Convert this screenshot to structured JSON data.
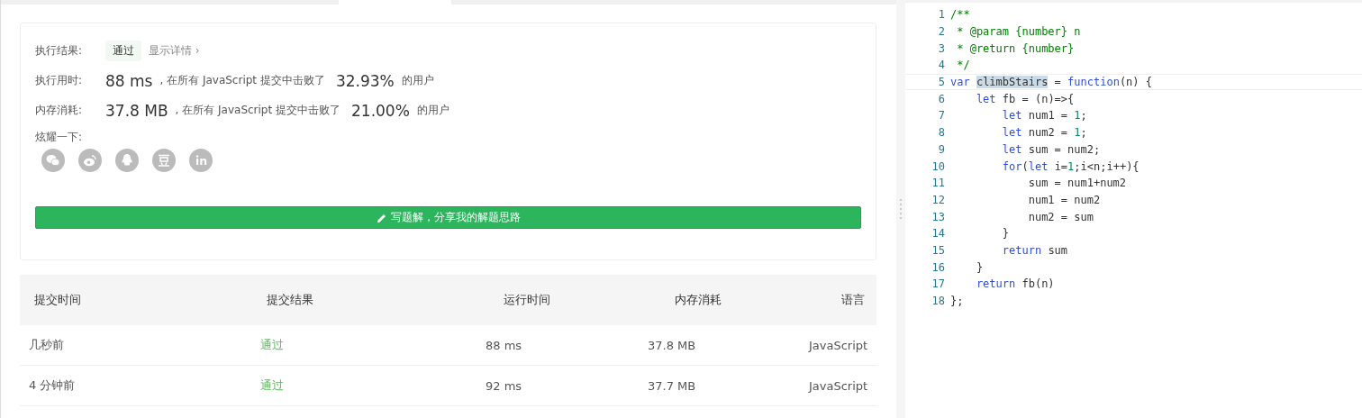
{
  "result": {
    "label": "执行结果:",
    "status": "通过",
    "details_link": "显示详情 ›"
  },
  "stats": [
    {
      "label": "执行用时:",
      "value": "88 ms",
      "middle": ", 在所有 JavaScript 提交中击败了",
      "percent": "32.93%",
      "suffix": "的用户"
    },
    {
      "label": "内存消耗:",
      "value": "37.8 MB",
      "middle": ", 在所有 JavaScript 提交中击败了",
      "percent": "21.00%",
      "suffix": "的用户"
    }
  ],
  "share": {
    "label": "炫耀一下:",
    "icons": [
      {
        "kind": "wechat"
      },
      {
        "kind": "weibo"
      },
      {
        "kind": "qq"
      },
      {
        "kind": "douban"
      },
      {
        "kind": "linkedin"
      }
    ]
  },
  "write_button": "写题解，分享我的解题思路",
  "table": {
    "columns": [
      "提交时间",
      "提交结果",
      "运行时间",
      "内存消耗",
      "语言"
    ],
    "rows": [
      {
        "time": "几秒前",
        "result": "通过",
        "runtime": "88 ms",
        "memory": "37.8 MB",
        "language": "JavaScript"
      },
      {
        "time": "4 分钟前",
        "result": "通过",
        "runtime": "92 ms",
        "memory": "37.7 MB",
        "language": "JavaScript"
      }
    ]
  },
  "code": {
    "lines": [
      {
        "number": "1",
        "selected": false,
        "tokens": [
          {
            "kind": "comment",
            "text": "/**"
          }
        ]
      },
      {
        "number": "2",
        "selected": false,
        "tokens": [
          {
            "kind": "comment",
            "text": " * @param {number} n"
          }
        ]
      },
      {
        "number": "3",
        "selected": false,
        "tokens": [
          {
            "kind": "comment",
            "text": " * @return {number}"
          }
        ]
      },
      {
        "number": "4",
        "selected": false,
        "tokens": [
          {
            "kind": "comment",
            "text": " */"
          }
        ]
      },
      {
        "number": "5",
        "selected": true,
        "tokens": [
          {
            "kind": "keyword",
            "text": "var "
          },
          {
            "kind": "highlight",
            "text": "climbStairs"
          },
          {
            "kind": "plain",
            "text": " = "
          },
          {
            "kind": "keyword",
            "text": "function"
          },
          {
            "kind": "plain",
            "text": "(n) {"
          }
        ]
      },
      {
        "number": "6",
        "selected": false,
        "tokens": [
          {
            "kind": "keyword",
            "text": "    let"
          },
          {
            "kind": "plain",
            "text": " fb = (n)=>{"
          }
        ]
      },
      {
        "number": "7",
        "selected": false,
        "tokens": [
          {
            "kind": "keyword",
            "text": "        let"
          },
          {
            "kind": "plain",
            "text": " num1 = "
          },
          {
            "kind": "number",
            "text": "1"
          },
          {
            "kind": "plain",
            "text": ";"
          }
        ]
      },
      {
        "number": "8",
        "selected": false,
        "tokens": [
          {
            "kind": "keyword",
            "text": "        let"
          },
          {
            "kind": "plain",
            "text": " num2 = "
          },
          {
            "kind": "number",
            "text": "1"
          },
          {
            "kind": "plain",
            "text": ";"
          }
        ]
      },
      {
        "number": "9",
        "selected": false,
        "tokens": [
          {
            "kind": "keyword",
            "text": "        let"
          },
          {
            "kind": "plain",
            "text": " sum = num2;"
          }
        ]
      },
      {
        "number": "10",
        "selected": false,
        "tokens": [
          {
            "kind": "keyword",
            "text": "        for"
          },
          {
            "kind": "plain",
            "text": "("
          },
          {
            "kind": "keyword",
            "text": "let"
          },
          {
            "kind": "plain",
            "text": " i="
          },
          {
            "kind": "number",
            "text": "1"
          },
          {
            "kind": "plain",
            "text": ";i<n;i++){"
          }
        ]
      },
      {
        "number": "11",
        "selected": false,
        "tokens": [
          {
            "kind": "plain",
            "text": "            sum = num1+num2"
          }
        ]
      },
      {
        "number": "12",
        "selected": false,
        "tokens": [
          {
            "kind": "plain",
            "text": "            num1 = num2"
          }
        ]
      },
      {
        "number": "13",
        "selected": false,
        "tokens": [
          {
            "kind": "plain",
            "text": "            num2 = sum"
          }
        ]
      },
      {
        "number": "14",
        "selected": false,
        "tokens": [
          {
            "kind": "plain",
            "text": "        }"
          }
        ]
      },
      {
        "number": "15",
        "selected": false,
        "tokens": [
          {
            "kind": "keyword",
            "text": "        return"
          },
          {
            "kind": "plain",
            "text": " sum"
          }
        ]
      },
      {
        "number": "16",
        "selected": false,
        "tokens": [
          {
            "kind": "plain",
            "text": "    }"
          }
        ]
      },
      {
        "number": "17",
        "selected": false,
        "tokens": [
          {
            "kind": "keyword",
            "text": "    return"
          },
          {
            "kind": "plain",
            "text": " fb(n)"
          }
        ]
      },
      {
        "number": "18",
        "selected": false,
        "tokens": [
          {
            "kind": "plain",
            "text": "};"
          }
        ]
      }
    ]
  }
}
